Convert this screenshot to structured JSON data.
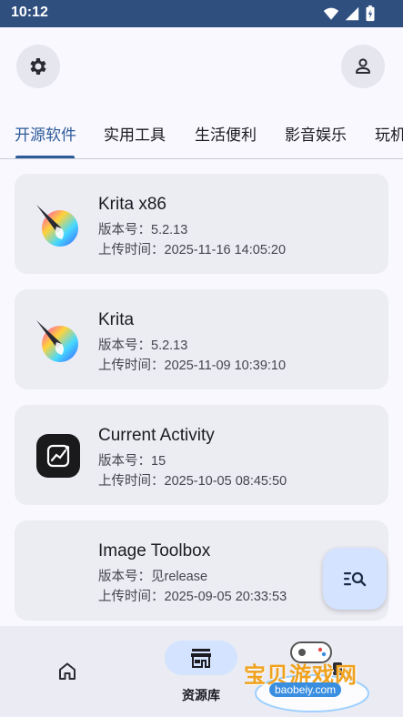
{
  "status_bar": {
    "time": "10:12"
  },
  "top_bar": {
    "settings_icon": "gear-icon",
    "profile_icon": "person-icon"
  },
  "tabs": [
    {
      "label": "开源软件",
      "active": true
    },
    {
      "label": "实用工具",
      "active": false
    },
    {
      "label": "生活便利",
      "active": false
    },
    {
      "label": "影音娱乐",
      "active": false
    },
    {
      "label": "玩机",
      "active": false
    }
  ],
  "apps": [
    {
      "name": "Krita x86",
      "version": "版本号：5.2.13",
      "uploaded": "上传时间：2025-11-16 14:05:20",
      "icon": "krita-icon"
    },
    {
      "name": "Krita",
      "version": "版本号：5.2.13",
      "uploaded": "上传时间：2025-11-09 10:39:10",
      "icon": "krita-icon"
    },
    {
      "name": "Current Activity",
      "version": "版本号：15",
      "uploaded": "上传时间：2025-10-05 08:45:50",
      "icon": "current-activity-icon"
    },
    {
      "name": "Image Toolbox",
      "version": "版本号：见release",
      "uploaded": "上传时间：2025-09-05 20:33:53",
      "icon": ""
    }
  ],
  "fab": {
    "icon": "search-list-icon"
  },
  "bottom_nav": {
    "items": [
      {
        "icon": "home-icon",
        "label": ""
      },
      {
        "icon": "store-icon",
        "label": "资源库",
        "active": true
      }
    ]
  },
  "watermark": {
    "text": "宝贝游戏网",
    "url": "baobeiy.com"
  },
  "colors": {
    "accent": "#2d5b9a",
    "status_bar": "#2f4f7f",
    "card": "#ececf3",
    "active_pill": "#d4e3ff"
  }
}
